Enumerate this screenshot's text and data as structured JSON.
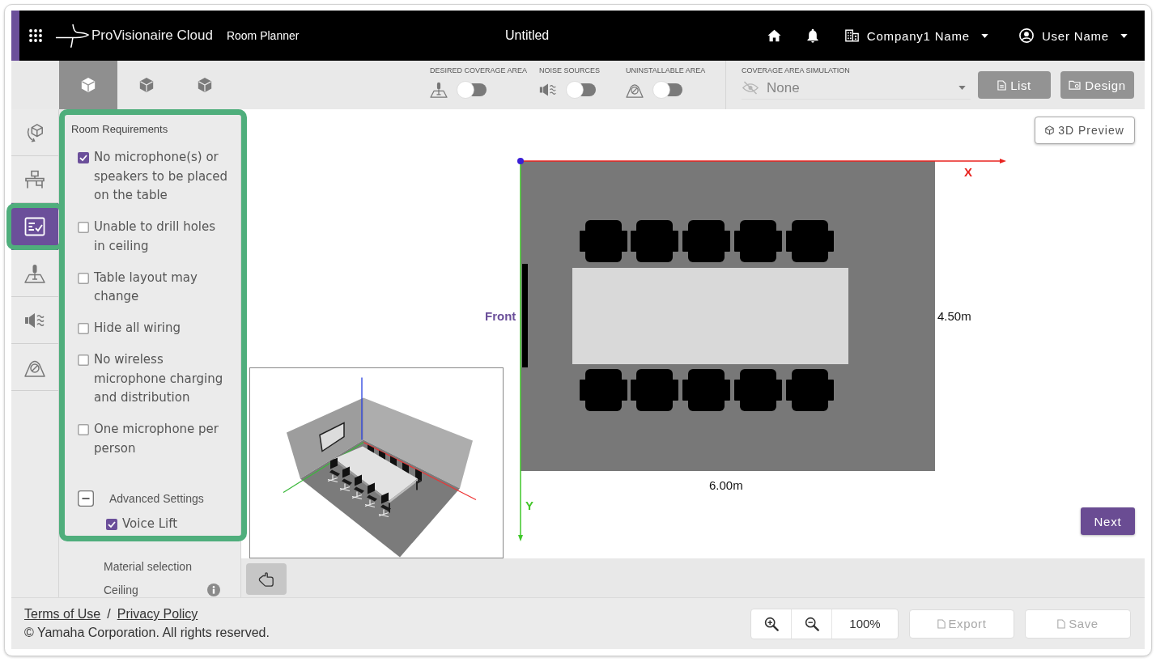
{
  "app_bar": {
    "product_name": "ProVisionaire Cloud",
    "module": "Room Planner",
    "document_title": "Untitled",
    "company": "Company1 Name",
    "user": "User Name"
  },
  "toolbar": {
    "view_tabs": [
      {
        "selected": true
      },
      {
        "selected": false
      },
      {
        "selected": false
      }
    ],
    "toggles": [
      {
        "label": "DESIRED COVERAGE AREA",
        "on": false
      },
      {
        "label": "NOISE SOURCES",
        "on": false
      },
      {
        "label": "UNINSTALLABLE AREA",
        "on": false
      }
    ],
    "simulation": {
      "label": "COVERAGE AREA SIMULATION",
      "value": "None",
      "disabled": true
    },
    "buttons": [
      {
        "label": "List",
        "disabled": true
      },
      {
        "label": "Design",
        "disabled": true
      }
    ]
  },
  "side_rail": {
    "items": [
      {
        "selected": false,
        "highlighted": false
      },
      {
        "selected": false,
        "highlighted": false
      },
      {
        "selected": true,
        "highlighted": true
      },
      {
        "selected": false,
        "highlighted": false
      },
      {
        "selected": false,
        "highlighted": false
      },
      {
        "selected": false,
        "highlighted": false
      }
    ]
  },
  "requirements_panel": {
    "title": "Room Requirements",
    "highlighted": true,
    "options": [
      {
        "label": "No microphone(s) or speakers to be placed on the table",
        "checked": true
      },
      {
        "label": "Unable to drill holes in ceiling",
        "checked": false
      },
      {
        "label": "Table layout may change",
        "checked": false
      },
      {
        "label": "Hide all wiring",
        "checked": false
      },
      {
        "label": "No wireless microphone charging and distribution",
        "checked": false
      },
      {
        "label": "One microphone per person",
        "checked": false
      }
    ],
    "advanced": {
      "label": "Advanced Settings",
      "expanded": true,
      "options": [
        {
          "label": "Voice Lift",
          "checked": true
        }
      ]
    },
    "material": {
      "title": "Material selection",
      "fields": [
        {
          "label": "Ceiling"
        }
      ]
    }
  },
  "canvas": {
    "preview_button": "3D Preview",
    "x_axis_label": "X",
    "y_axis_label": "Y",
    "front_label": "Front",
    "depth_label": "4.50m",
    "width_label": "6.00m",
    "next_button": "Next"
  },
  "footer": {
    "links": [
      "Terms of Use",
      "Privacy Policy"
    ],
    "separator": "/",
    "copyright": "© Yamaha Corporation. All rights reserved.",
    "zoom_level": "100%",
    "buttons": [
      {
        "label": "Export",
        "disabled": true
      },
      {
        "label": "Save",
        "disabled": true
      }
    ]
  }
}
